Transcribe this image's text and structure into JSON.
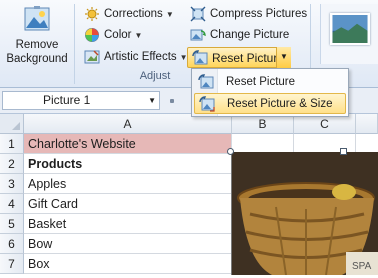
{
  "ribbon": {
    "remove_background": "Remove Background",
    "corrections": "Corrections",
    "color": "Color",
    "artistic_effects": "Artistic Effects",
    "compress_pictures": "Compress Pictures",
    "change_picture": "Change Picture",
    "reset_picture": "Reset Picture",
    "group_label": "Adjust"
  },
  "dropdown": {
    "items": [
      {
        "label": "Reset Picture"
      },
      {
        "label": "Reset Picture & Size"
      }
    ]
  },
  "formula_bar": {
    "name_box_value": "Picture 1"
  },
  "grid": {
    "columns": [
      "A",
      "B",
      "C"
    ],
    "rows": [
      {
        "num": "1",
        "a": "Charlotte's Website"
      },
      {
        "num": "2",
        "a": "Products"
      },
      {
        "num": "3",
        "a": "Apples"
      },
      {
        "num": "4",
        "a": "Gift Card"
      },
      {
        "num": "5",
        "a": "Basket"
      },
      {
        "num": "6",
        "a": "Bow"
      },
      {
        "num": "7",
        "a": "Box"
      }
    ]
  },
  "colors": {
    "header_fill": "#e6b8b7",
    "highlight": "#ffe08a"
  }
}
